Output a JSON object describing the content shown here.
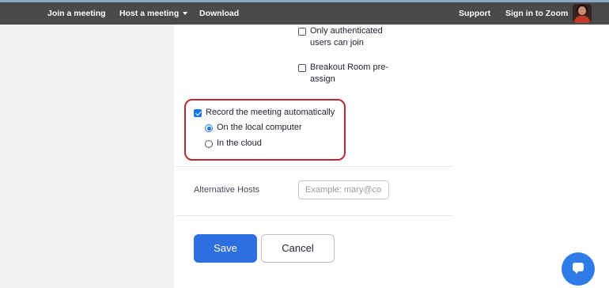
{
  "nav": {
    "join": "Join a meeting",
    "host": "Host a meeting",
    "download": "Download",
    "support": "Support",
    "signin": "Sign in to Zoom"
  },
  "options": {
    "only_auth_line1": "Only authenticated",
    "only_auth_line2": "users can join",
    "breakout_line1": "Breakout Room pre-",
    "breakout_line2": "assign",
    "record_auto": "Record the meeting automatically",
    "local_computer": "On the local computer",
    "cloud": "In the cloud"
  },
  "alternative_hosts": {
    "label": "Alternative Hosts",
    "placeholder": "Example: mary@company.com"
  },
  "buttons": {
    "save": "Save",
    "cancel": "Cancel"
  },
  "colors": {
    "accent": "#2d6fe0",
    "highlight": "#b52a36"
  },
  "icons": {
    "host_menu": "caret-down-icon",
    "chat": "chat-bubble-icon"
  }
}
